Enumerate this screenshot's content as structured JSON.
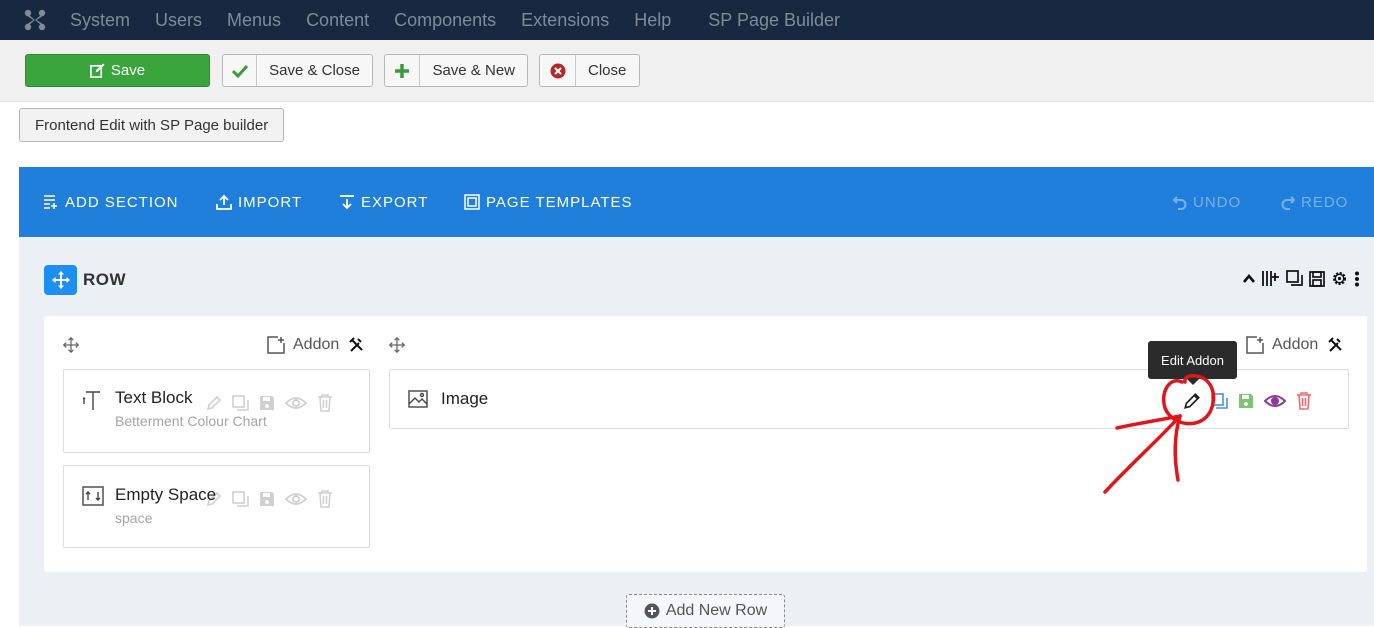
{
  "topbar": {
    "menu": [
      "System",
      "Users",
      "Menus",
      "Content",
      "Components",
      "Extensions",
      "Help"
    ],
    "app_name": "SP Page Builder"
  },
  "toolbar": {
    "save_label": "Save",
    "save_close_label": "Save & Close",
    "save_new_label": "Save & New",
    "close_label": "Close",
    "frontend_label": "Frontend Edit with SP Page builder"
  },
  "builder": {
    "add_section": "ADD SECTION",
    "import": "IMPORT",
    "export": "EXPORT",
    "page_templates": "PAGE TEMPLATES",
    "undo": "UNDO",
    "redo": "REDO"
  },
  "row": {
    "title": "ROW",
    "columns": [
      {
        "addon_label": "Addon",
        "addons": [
          {
            "title": "Text Block",
            "subtitle": "Betterment Colour Chart"
          },
          {
            "title": "Empty Space",
            "subtitle": "space"
          }
        ]
      },
      {
        "addon_label": "Addon",
        "addons": [
          {
            "title": "Image"
          }
        ]
      }
    ]
  },
  "tooltip": {
    "text": "Edit Addon"
  },
  "add_row_label": "Add New Row",
  "colors": {
    "topbar": "#172840",
    "builder_bar": "#1f7fdb",
    "save_green": "#3aa53d",
    "annotation_red": "#e0161c",
    "eye_purple": "#8e3a99",
    "trash_red": "#ef6b6b",
    "save_icon_green": "#7cc576",
    "copy_blue": "#4b8fde"
  }
}
